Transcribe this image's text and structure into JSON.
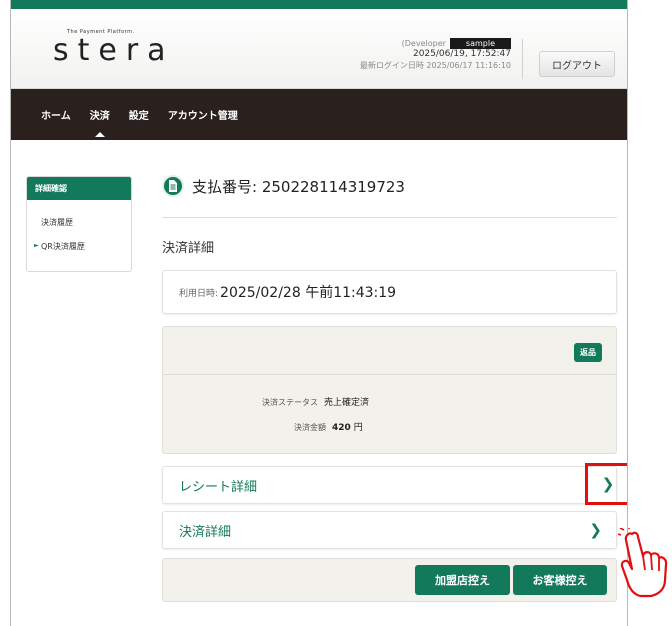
{
  "brand": {
    "tagline": "The Payment Platform.",
    "wordmark": "stera"
  },
  "header": {
    "developer_prefix": "(Developer",
    "developer_name": "sample",
    "current_time": "2025/06/19, 17:52:47",
    "last_login": "最新ログイン日時 2025/06/17 11:16:10",
    "logout_label": "ログアウト"
  },
  "nav": {
    "items": [
      {
        "label": "ホーム"
      },
      {
        "label": "決済"
      },
      {
        "label": "設定"
      },
      {
        "label": "アカウント管理"
      }
    ]
  },
  "sidebar": {
    "header": "詳細確認",
    "items": [
      {
        "label": "決済履歴"
      },
      {
        "label": "QR決済履歴"
      }
    ]
  },
  "main": {
    "payment_title": "支払番号: 250228114319723",
    "section_title": "決済詳細",
    "date_label": "利用日時:",
    "date_value": "2025/02/28 午前11:43:19",
    "refund_label": "返品",
    "status_label": "決済ステータス",
    "status_value": "売上確定済",
    "amount_label": "決済金額",
    "amount_value": "420",
    "amount_unit": "円",
    "receipt_link": "レシート詳細",
    "detail_link": "決済詳細",
    "merchant_copy": "加盟店控え",
    "customer_copy": "お客様控え"
  },
  "colors": {
    "brand_green": "#127a5a",
    "nav_bg": "#2a201d",
    "highlight_red": "#e01010"
  }
}
